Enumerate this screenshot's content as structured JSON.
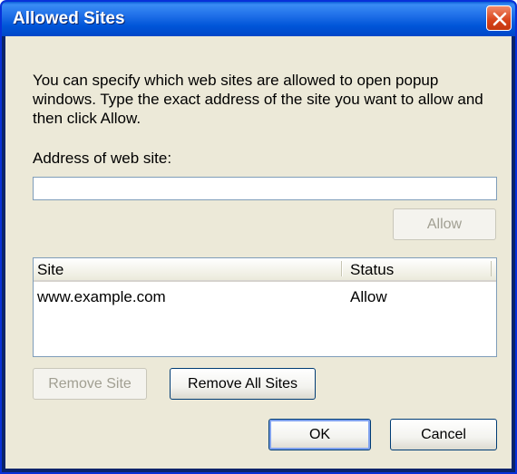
{
  "window": {
    "title": "Allowed Sites",
    "close_icon": "close-icon"
  },
  "description": "You can specify which web sites are allowed to open popup windows. Type the exact address of the site you want to allow and then click Allow.",
  "address": {
    "label": "Address of web site:",
    "value": "",
    "placeholder": ""
  },
  "buttons": {
    "allow": "Allow",
    "remove_site": "Remove Site",
    "remove_all_sites": "Remove All Sites",
    "ok": "OK",
    "cancel": "Cancel"
  },
  "sites_table": {
    "columns": [
      "Site",
      "Status"
    ],
    "rows": [
      {
        "site": "www.example.com",
        "status": "Allow"
      }
    ]
  },
  "colors": {
    "titlebar": "#0055d8",
    "dialog_bg": "#ece9d8",
    "close_button": "#d8431a"
  }
}
